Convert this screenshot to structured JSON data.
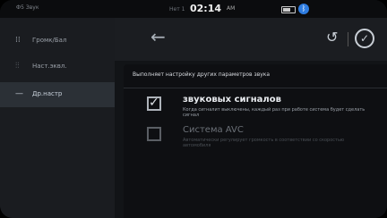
{
  "status": {
    "carrier": "Ф5 Звук",
    "date": "Нет 1",
    "time": "02:14",
    "ampm": "AM",
    "bt_icon": "bluetooth-icon"
  },
  "sidebar": {
    "items": [
      {
        "label": "Громк/Бал",
        "icon": "equalizer-icon",
        "active": false
      },
      {
        "label": "Наст.эквл.",
        "icon": "sliders-icon",
        "active": false
      },
      {
        "label": "Др.настр",
        "icon": "menu-icon",
        "active": true
      }
    ]
  },
  "header": {
    "back_icon": "arrow-left-icon",
    "reset_icon": "reset-icon",
    "ok_icon": "check-circle-icon"
  },
  "panel": {
    "description": "Выполняет настройку других параметров звука",
    "options": [
      {
        "title": "звуковых сигналов",
        "subtitle": "Когда сигналит выключены, каждый раз при работе система будет сделать сигнал",
        "checked": true,
        "disabled": false
      },
      {
        "title": "Система AVC",
        "subtitle": "Автоматически регулирует громкость в соответствии со скоростью автомобиля",
        "checked": false,
        "disabled": true
      }
    ]
  },
  "colors": {
    "background": "#121417",
    "sidebar": "#1a1c20",
    "active": "#2b3036",
    "accent_bt": "#2f7de1"
  }
}
